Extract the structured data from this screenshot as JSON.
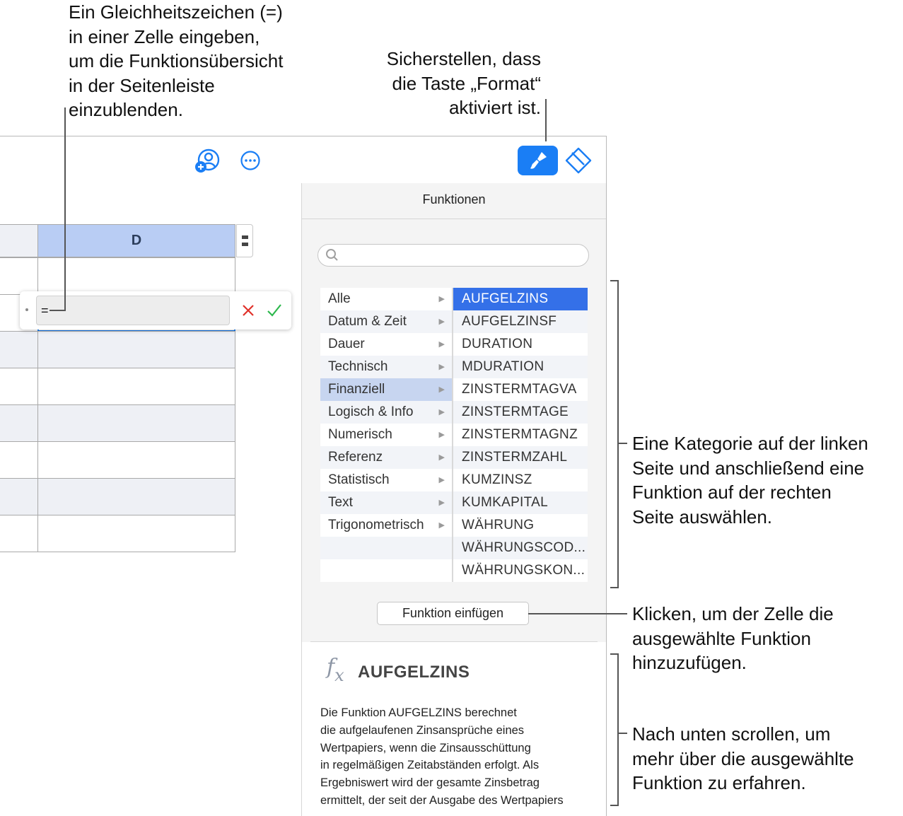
{
  "callouts": {
    "top_left": "Ein Gleichheitszeichen (=)\nin einer Zelle eingeben,\num die Funktionsübersicht\nin der Seitenleiste\neinzublenden.",
    "top_right": "Sicherstellen, dass\ndie Taste „Format“\naktiviert ist.",
    "right_category": "Eine Kategorie auf der linken\nSeite und anschließend eine\nFunktion auf der rechten\nSeite auswählen.",
    "right_insert": "Klicken, um der Zelle die\nausgewählte Funktion\nhinzuzufügen.",
    "right_scroll": "Nach unten scrollen, um\nmehr über die ausgewählte\nFunktion zu erfahren."
  },
  "toolbar": {
    "collaborate_icon": "person-add-icon",
    "more_icon": "ellipsis-circle-icon",
    "format_icon": "paintbrush-icon",
    "organize_icon": "organize-diamond-icon",
    "accent": "#1a7ef5"
  },
  "table": {
    "column_header": "D",
    "formula_value": "="
  },
  "sidebar": {
    "title": "Funktionen",
    "search_placeholder": "",
    "categories": [
      {
        "label": "Alle"
      },
      {
        "label": "Datum & Zeit"
      },
      {
        "label": "Dauer"
      },
      {
        "label": "Technisch"
      },
      {
        "label": "Finanziell"
      },
      {
        "label": "Logisch & Info"
      },
      {
        "label": "Numerisch"
      },
      {
        "label": "Referenz"
      },
      {
        "label": "Statistisch"
      },
      {
        "label": "Text"
      },
      {
        "label": "Trigonometrisch"
      }
    ],
    "selected_category": "Finanziell",
    "functions": [
      "AUFGELZINS",
      "AUFGELZINSF",
      "DURATION",
      "MDURATION",
      "ZINSTERMTAGVA",
      "ZINSTERMTAGE",
      "ZINSTERMTAGNZ",
      "ZINSTERMZAHL",
      "KUMZINSZ",
      "KUMKAPITAL",
      "WÄHRUNG",
      "WÄHRUNGSCOD...",
      "WÄHRUNGSKON..."
    ],
    "selected_function": "AUFGELZINS",
    "insert_button": "Funktion einfügen",
    "detail": {
      "icon": "fx-icon",
      "name": "AUFGELZINS",
      "description": "Die Funktion AUFGELZINS berechnet\ndie aufgelaufenen Zinsansprüche eines\nWertpapiers, wenn die Zinsausschüttung\nin regelmäßigen Zeitabständen erfolgt. Als\nErgebniswert wird der gesamte Zinsbetrag\nermittelt, der seit der Ausgabe des Wertpapiers"
    }
  }
}
